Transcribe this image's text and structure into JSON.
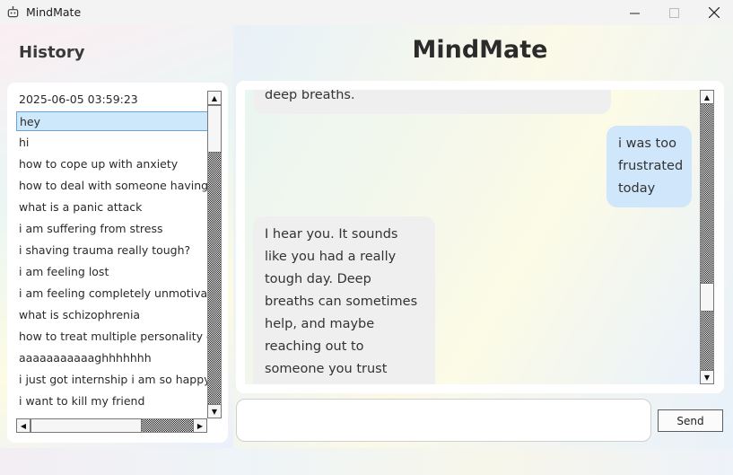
{
  "window": {
    "title": "MindMate",
    "icon": "robot-icon"
  },
  "history": {
    "title": "History",
    "items": [
      "2025-06-05 03:59:23",
      "hey",
      "hi",
      "how to cope up with anxiety",
      "how to deal with someone having p",
      "what is a panic attack",
      "i am suffering from stress",
      "i shaving trauma really tough?",
      "i am feeling lost",
      "i am feeling completely unmotivate",
      "what is schizophrenia",
      "how to treat multiple personality di",
      "aaaaaaaaaaaghhhhhhh",
      "i just got internship i am so happy",
      "i want to kill my friend"
    ],
    "selected_index": 1
  },
  "main": {
    "heading": "MindMate",
    "messages": [
      {
        "role": "bot",
        "text": "deep breaths."
      },
      {
        "role": "user",
        "text": "i was too frustrated today"
      },
      {
        "role": "bot",
        "text": "I hear you. It sounds like you had a really tough day. Deep breaths can sometimes help, and maybe reaching out to someone you trust would feel good."
      }
    ],
    "input_value": "",
    "send_label": "Send"
  },
  "colors": {
    "user_bubble": "#cfe6fb",
    "bot_bubble": "#efefef",
    "selected_item": "#cde8fb"
  }
}
